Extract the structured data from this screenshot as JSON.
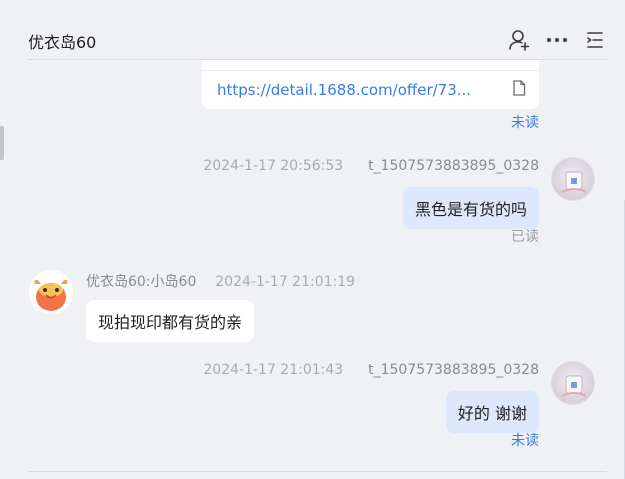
{
  "header": {
    "title": "优衣岛60",
    "icons": [
      "add-contact-icon",
      "more-icon",
      "menu-list-icon"
    ]
  },
  "link_card": {
    "url": "https://detail.1688.com/offer/73...",
    "icon": "document-icon",
    "status": "未读"
  },
  "messages": [
    {
      "direction": "outgoing",
      "time": "2024-1-17 20:56:53",
      "sender": "t_1507573883895_0328",
      "text": "黑色是有货的吗",
      "status": "已读"
    },
    {
      "direction": "incoming",
      "sender": "优衣岛60:小岛60",
      "time": "2024-1-17 21:01:19",
      "text": "现拍现印都有货的亲"
    },
    {
      "direction": "outgoing",
      "time": "2024-1-17 21:01:43",
      "sender": "t_1507573883895_0328",
      "text": "好的 谢谢",
      "status": "未读"
    }
  ],
  "colors": {
    "background": "#f0f1f5",
    "self_bubble": "#dde8fc",
    "link": "#3a7ce0",
    "unread": "#3a7ce0",
    "read": "#9a9ca3"
  }
}
